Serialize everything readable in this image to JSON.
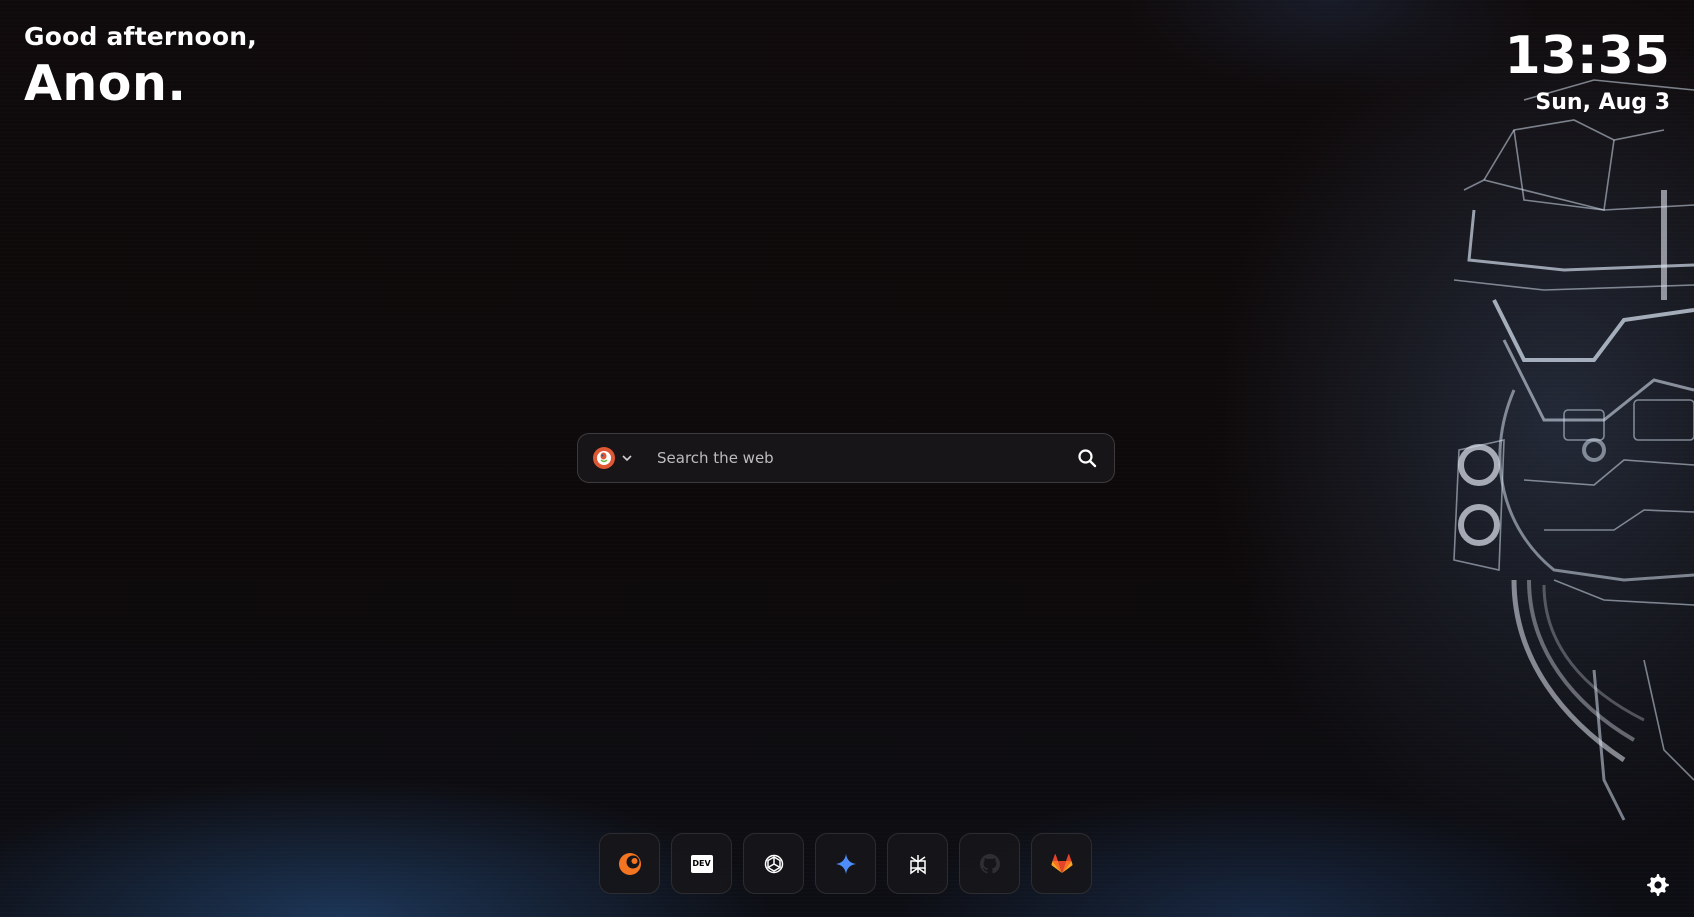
{
  "greeting": {
    "salutation": "Good afternoon,",
    "name": "Anon."
  },
  "clock": {
    "time": "13:35",
    "date": "Sun, Aug 3"
  },
  "search": {
    "engine_icon": "duckduckgo-icon",
    "engine_color": "#de5833",
    "placeholder": "Search the web",
    "value": ""
  },
  "dock": {
    "items": [
      {
        "name": "crunchyroll",
        "icon": "crunchyroll-icon",
        "color": "#f47521"
      },
      {
        "name": "dev",
        "icon": "dev-icon",
        "label": "DEV"
      },
      {
        "name": "chatgpt",
        "icon": "openai-icon",
        "color": "#ffffff"
      },
      {
        "name": "gemini",
        "icon": "gemini-sparkle-icon",
        "color": "#4e8cf7"
      },
      {
        "name": "perplexity",
        "icon": "perplexity-icon",
        "color": "#ffffff"
      },
      {
        "name": "github",
        "icon": "github-icon",
        "color": "#2b2b2f"
      },
      {
        "name": "gitlab",
        "icon": "gitlab-icon",
        "color": "#e24329"
      }
    ]
  },
  "settings": {
    "icon": "gear-icon"
  }
}
